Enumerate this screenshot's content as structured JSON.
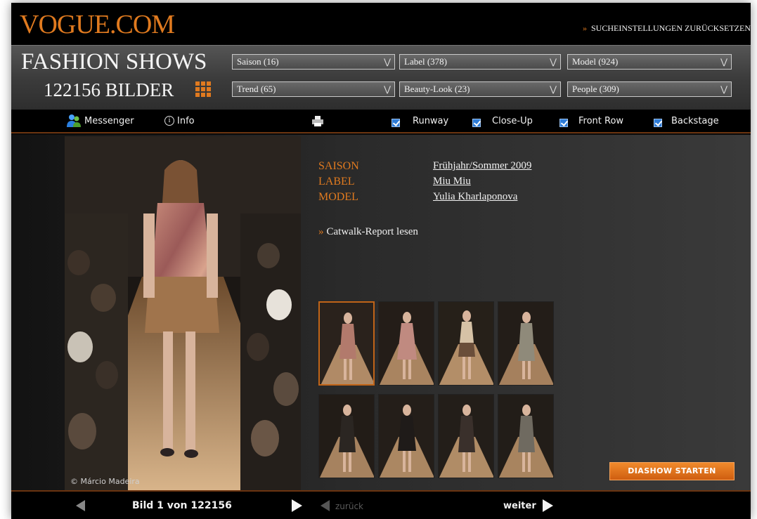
{
  "header": {
    "logo": "VOGUE.COM",
    "reset_link": "SUCHEINSTELLUNGEN ZURÜCKSETZEN",
    "reset_prefix": "»"
  },
  "filters": {
    "title": "FASHION SHOWS",
    "count_label": "122156 BILDER",
    "dropdowns": [
      {
        "label": "Saison (16)"
      },
      {
        "label": "Label (378)"
      },
      {
        "label": "Model (924)"
      },
      {
        "label": "Trend (65)"
      },
      {
        "label": "Beauty-Look (23)"
      },
      {
        "label": "People (309)"
      }
    ]
  },
  "nav": {
    "messenger": "Messenger",
    "info": "Info",
    "views": [
      {
        "label": "Runway",
        "checked": true
      },
      {
        "label": "Close-Up",
        "checked": true
      },
      {
        "label": "Front Row",
        "checked": true
      },
      {
        "label": "Backstage",
        "checked": true
      }
    ]
  },
  "photo": {
    "caption": "© Márcio Madeira"
  },
  "details": {
    "labels": [
      "SAISON",
      "LABEL",
      "MODEL"
    ],
    "values": [
      "Frühjahr/Sommer 2009",
      "Miu Miu",
      "Yulia Kharlaponova"
    ],
    "report_link": "Catwalk-Report lesen",
    "report_prefix": "»"
  },
  "diashow_button": "DIASHOW STARTEN",
  "pager": {
    "position_label": "Bild 1 von 122156",
    "prev_label": "zurück",
    "next_label": "weiter"
  },
  "colors": {
    "accent": "#e07a1f",
    "checkbox": "#2e7bd6",
    "background": "#0b0b0b"
  }
}
